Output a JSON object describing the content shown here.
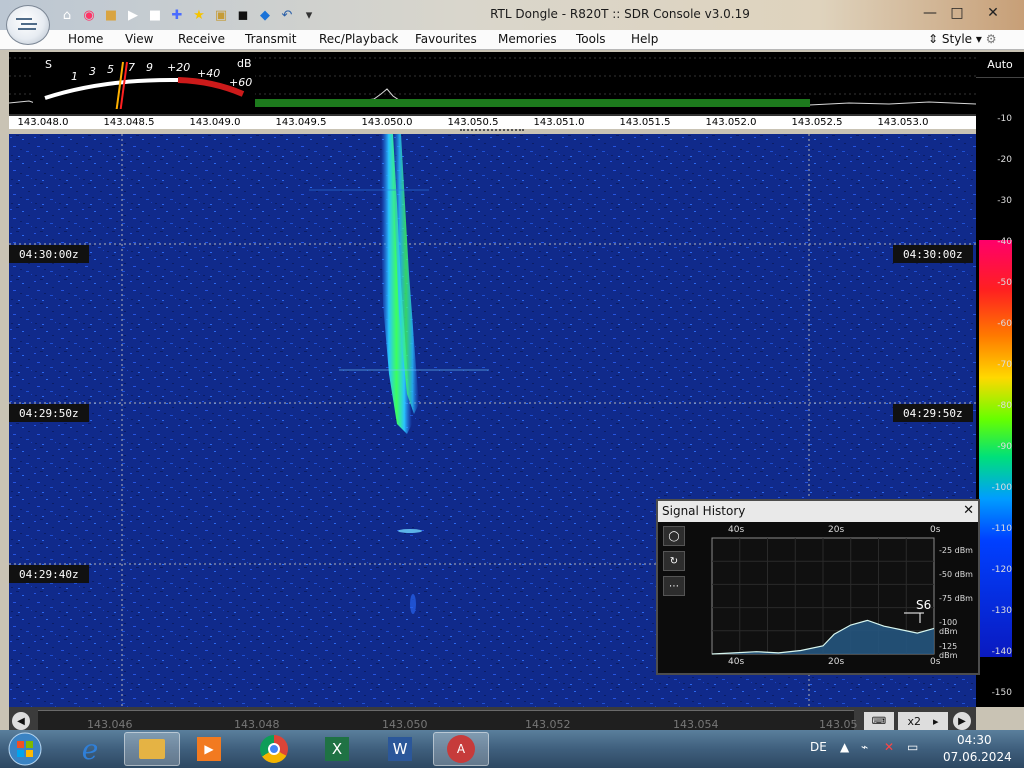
{
  "window": {
    "title": "RTL Dongle - R820T :: SDR Console v3.0.19",
    "minimize_icon": "minimize-icon",
    "maximize_icon": "maximize-icon",
    "close_icon": "close-icon"
  },
  "quick_access_icons": [
    "home-icon",
    "help-ring-icon",
    "folder-icon",
    "play-icon",
    "stop-icon",
    "add-icon",
    "star-icon",
    "lock-icon",
    "camera-icon",
    "drop-icon",
    "undo-icon",
    "dropdown-icon"
  ],
  "menu": {
    "items": [
      "Home",
      "View",
      "Receive",
      "Transmit",
      "Rec/Playback",
      "Favourites",
      "Memories",
      "Tools",
      "Help"
    ],
    "style_label": "Style"
  },
  "smeter": {
    "s_label": "S",
    "db_label": "dB",
    "s_scale": [
      "1",
      "3",
      "5",
      "7",
      "9"
    ],
    "db_scale": [
      "+20",
      "+40",
      "+60"
    ]
  },
  "frequency_axis": [
    "143.048.0",
    "143.048.5",
    "143.049.0",
    "143.049.5",
    "143.050.0",
    "143.050.5",
    "143.051.0",
    "143.051.5",
    "143.052.0",
    "143.052.5",
    "143.053.0"
  ],
  "waterfall_times": [
    "04:30:00z",
    "04:29:50z",
    "04:29:40z"
  ],
  "color_scale": {
    "auto_label": "Auto",
    "labels": [
      "-10",
      "-20",
      "-30",
      "-40",
      "-50",
      "-60",
      "-70",
      "-80",
      "-90",
      "-100",
      "-110",
      "-120",
      "-130",
      "-140",
      "-150"
    ]
  },
  "bottom_axis": {
    "labels": [
      "143.046",
      "143.048",
      "143.050",
      "143.052",
      "143.054",
      "143.05"
    ],
    "zoom_label": "x2"
  },
  "signal_history": {
    "title": "Signal History",
    "top_time_labels": [
      "40s",
      "20s",
      "0s"
    ],
    "bottom_time_labels": [
      "40s",
      "20s",
      "0s"
    ],
    "dbm_labels": [
      "-25 dBm",
      "-50 dBm",
      "-75 dBm",
      "-100 dBm",
      "-125 dBm"
    ],
    "current_s": "S6",
    "traces": [
      {
        "t": 40,
        "dbm": -125
      },
      {
        "t": 36,
        "dbm": -124
      },
      {
        "t": 32,
        "dbm": -123
      },
      {
        "t": 28,
        "dbm": -124
      },
      {
        "t": 24,
        "dbm": -122
      },
      {
        "t": 20,
        "dbm": -118
      },
      {
        "t": 18,
        "dbm": -108
      },
      {
        "t": 15,
        "dbm": -100
      },
      {
        "t": 12,
        "dbm": -96
      },
      {
        "t": 9,
        "dbm": -101
      },
      {
        "t": 6,
        "dbm": -104
      },
      {
        "t": 3,
        "dbm": -107
      },
      {
        "t": 0,
        "dbm": -103
      }
    ]
  },
  "taskbar": {
    "apps": [
      "windows-logo-icon",
      "internet-explorer-icon",
      "file-explorer-icon",
      "media-player-icon",
      "chrome-icon",
      "excel-icon",
      "word-icon",
      "sdr-console-icon"
    ],
    "language": "DE",
    "time": "04:30",
    "date": "07.06.2024"
  },
  "colors": {
    "waterfall_bg": "#102a8b",
    "signal": "#3cff5d",
    "taskbar": "#3f5f7d"
  }
}
